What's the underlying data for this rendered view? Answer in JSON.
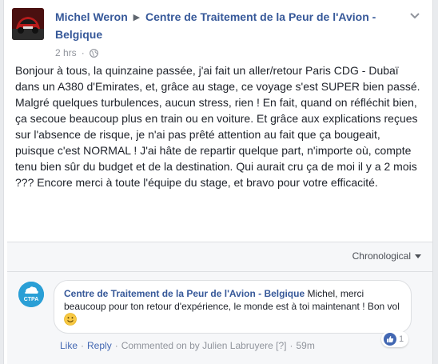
{
  "post": {
    "author": "Michel Weron",
    "group": "Centre de Traitement de la Peur de l'Avion - Belgique",
    "time": "2 hrs",
    "dot": "·",
    "text": "Bonjour à tous, la quinzaine passée, j'ai fait un aller/retour Paris CDG - Dubaï dans un A380 d'Emirates, et, grâce au stage, ce voyage s'est SUPER bien passé. Malgré quelques turbulences, aucun stress, rien ! En fait, quand on réfléchit bien, ça secoue beaucoup plus en train ou en voiture. Et grâce aux explications reçues sur l'absence de risque, je n'ai pas prêté attention au fait que ça bougeait, puisque c'est NORMAL ! J'ai hâte de repartir quelque part, n'importe où, compte tenu bien sûr du budget et de la destination. Qui aurait cru ça de moi il y a 2 mois ??? Encore merci à toute l'équipe du stage, et bravo pour votre efficacité."
  },
  "sort": {
    "label": "Chronological"
  },
  "comment": {
    "avatar_label": "CTPA",
    "author": "Centre de Traitement de la Peur de l'Avion - Belgique",
    "text": "Michel, merci beaucoup pour ton retour d'expérience, le monde est à toi maintenant ! Bon vol",
    "reaction_count": "1",
    "like_label": "Like",
    "reply_label": "Reply",
    "commented_on_by": "Commented on by Julien Labruyere",
    "help_mark": "[?]",
    "time": "59m",
    "separator": "·"
  },
  "icons": {
    "globe": "globe-icon",
    "chevron": "chevron-down-icon",
    "like": "like-icon",
    "smiley": "smiley-emoji"
  },
  "colors": {
    "link": "#365899",
    "action_link": "#4267b2",
    "meta": "#90949c",
    "background": "#e9ebee"
  }
}
